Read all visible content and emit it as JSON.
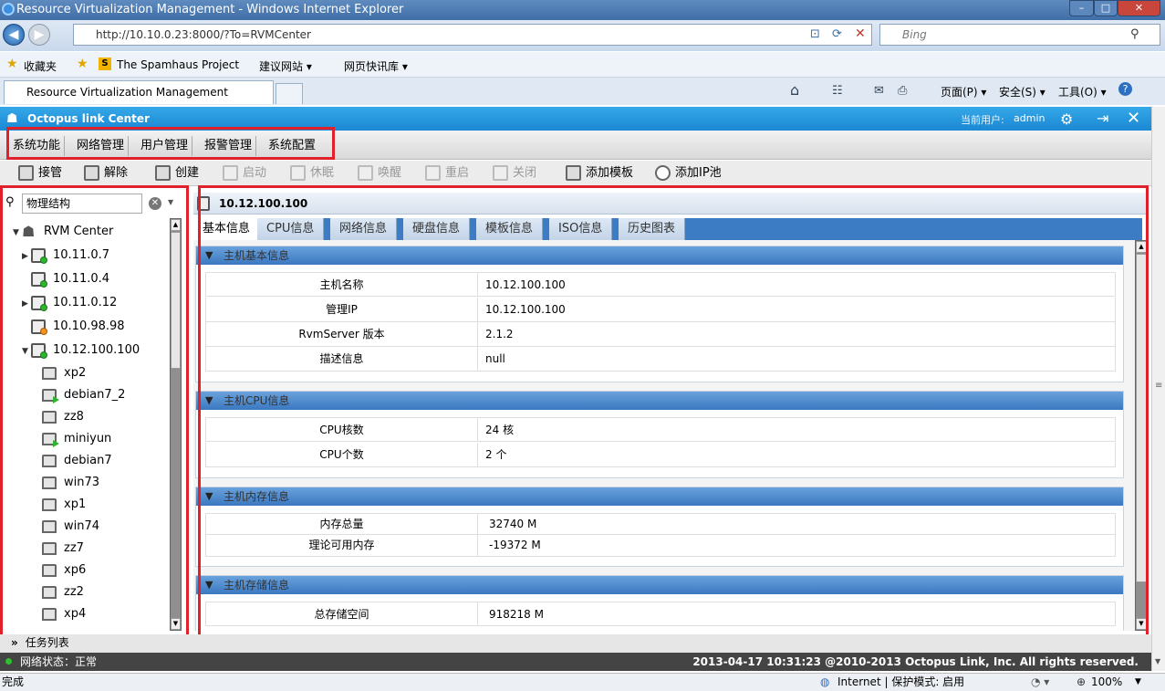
{
  "browser": {
    "window_title": "Resource Virtualization Management - Windows Internet Explorer",
    "address": "http://10.10.0.23:8000/?To=RVMCenter",
    "search_placeholder": "Bing",
    "favorites": [
      "收藏夹",
      "The Spamhaus Project",
      "建议网站 ▾",
      "网页快讯库 ▾"
    ],
    "tab_title": "Resource Virtualization Management",
    "commands": [
      "页面(P) ▾",
      "安全(S) ▾",
      "工具(O) ▾"
    ],
    "status_left": "完成",
    "status_zone": "Internet | 保护模式: 启用",
    "zoom": "100%"
  },
  "app": {
    "title": "Octopus link Center",
    "user_label": "当前用户:",
    "user": "admin",
    "menu": [
      "系统功能",
      "网络管理",
      "用户管理",
      "报警管理",
      "系统配置"
    ],
    "toolbar": [
      {
        "label": "接管",
        "enabled": true
      },
      {
        "label": "解除",
        "enabled": true
      },
      {
        "label": "创建",
        "enabled": true
      },
      {
        "label": "启动",
        "enabled": false
      },
      {
        "label": "休眠",
        "enabled": false
      },
      {
        "label": "唤醒",
        "enabled": false
      },
      {
        "label": "重启",
        "enabled": false
      },
      {
        "label": "关闭",
        "enabled": false
      },
      {
        "label": "添加模板",
        "enabled": true
      },
      {
        "label": "添加IP池",
        "enabled": true
      }
    ],
    "search_value": "物理结构",
    "tree": {
      "root": "RVM Center",
      "hosts": [
        "10.11.0.7",
        "10.11.0.4",
        "10.11.0.12",
        "10.10.98.98",
        "10.12.100.100"
      ],
      "vms": [
        "xp2",
        "debian7_2",
        "zz8",
        "miniyun",
        "debian7",
        "win73",
        "xp1",
        "win74",
        "zz7",
        "xp6",
        "zz2",
        "xp4"
      ]
    },
    "selected_host": "10.12.100.100",
    "tabs": [
      "基本信息",
      "CPU信息",
      "网络信息",
      "硬盘信息",
      "模板信息",
      "ISO信息",
      "历史图表"
    ],
    "sections": {
      "basic": {
        "title": "主机基本信息",
        "rows": [
          {
            "k": "主机名称",
            "v": "10.12.100.100"
          },
          {
            "k": "管理IP",
            "v": "10.12.100.100"
          },
          {
            "k": "RvmServer 版本",
            "v": "2.1.2"
          },
          {
            "k": "描述信息",
            "v": "null"
          }
        ]
      },
      "cpu": {
        "title": "主机CPU信息",
        "rows": [
          {
            "k": "CPU核数",
            "v": "24 核"
          },
          {
            "k": "CPU个数",
            "v": "2 个"
          }
        ]
      },
      "mem": {
        "title": "主机内存信息",
        "rows": [
          {
            "k": "内存总量",
            "v": "32740 M"
          },
          {
            "k": "理论可用内存",
            "v": "-19372 M"
          }
        ]
      },
      "storage": {
        "title": "主机存储信息",
        "rows": [
          {
            "k": "总存储空间",
            "v": "918218 M"
          }
        ]
      }
    },
    "task_list": "任务列表",
    "network_status": "网络状态：正常",
    "copyright": "2013-04-17 10:31:23  @2010-2013 Octopus Link, Inc. All rights reserved."
  }
}
